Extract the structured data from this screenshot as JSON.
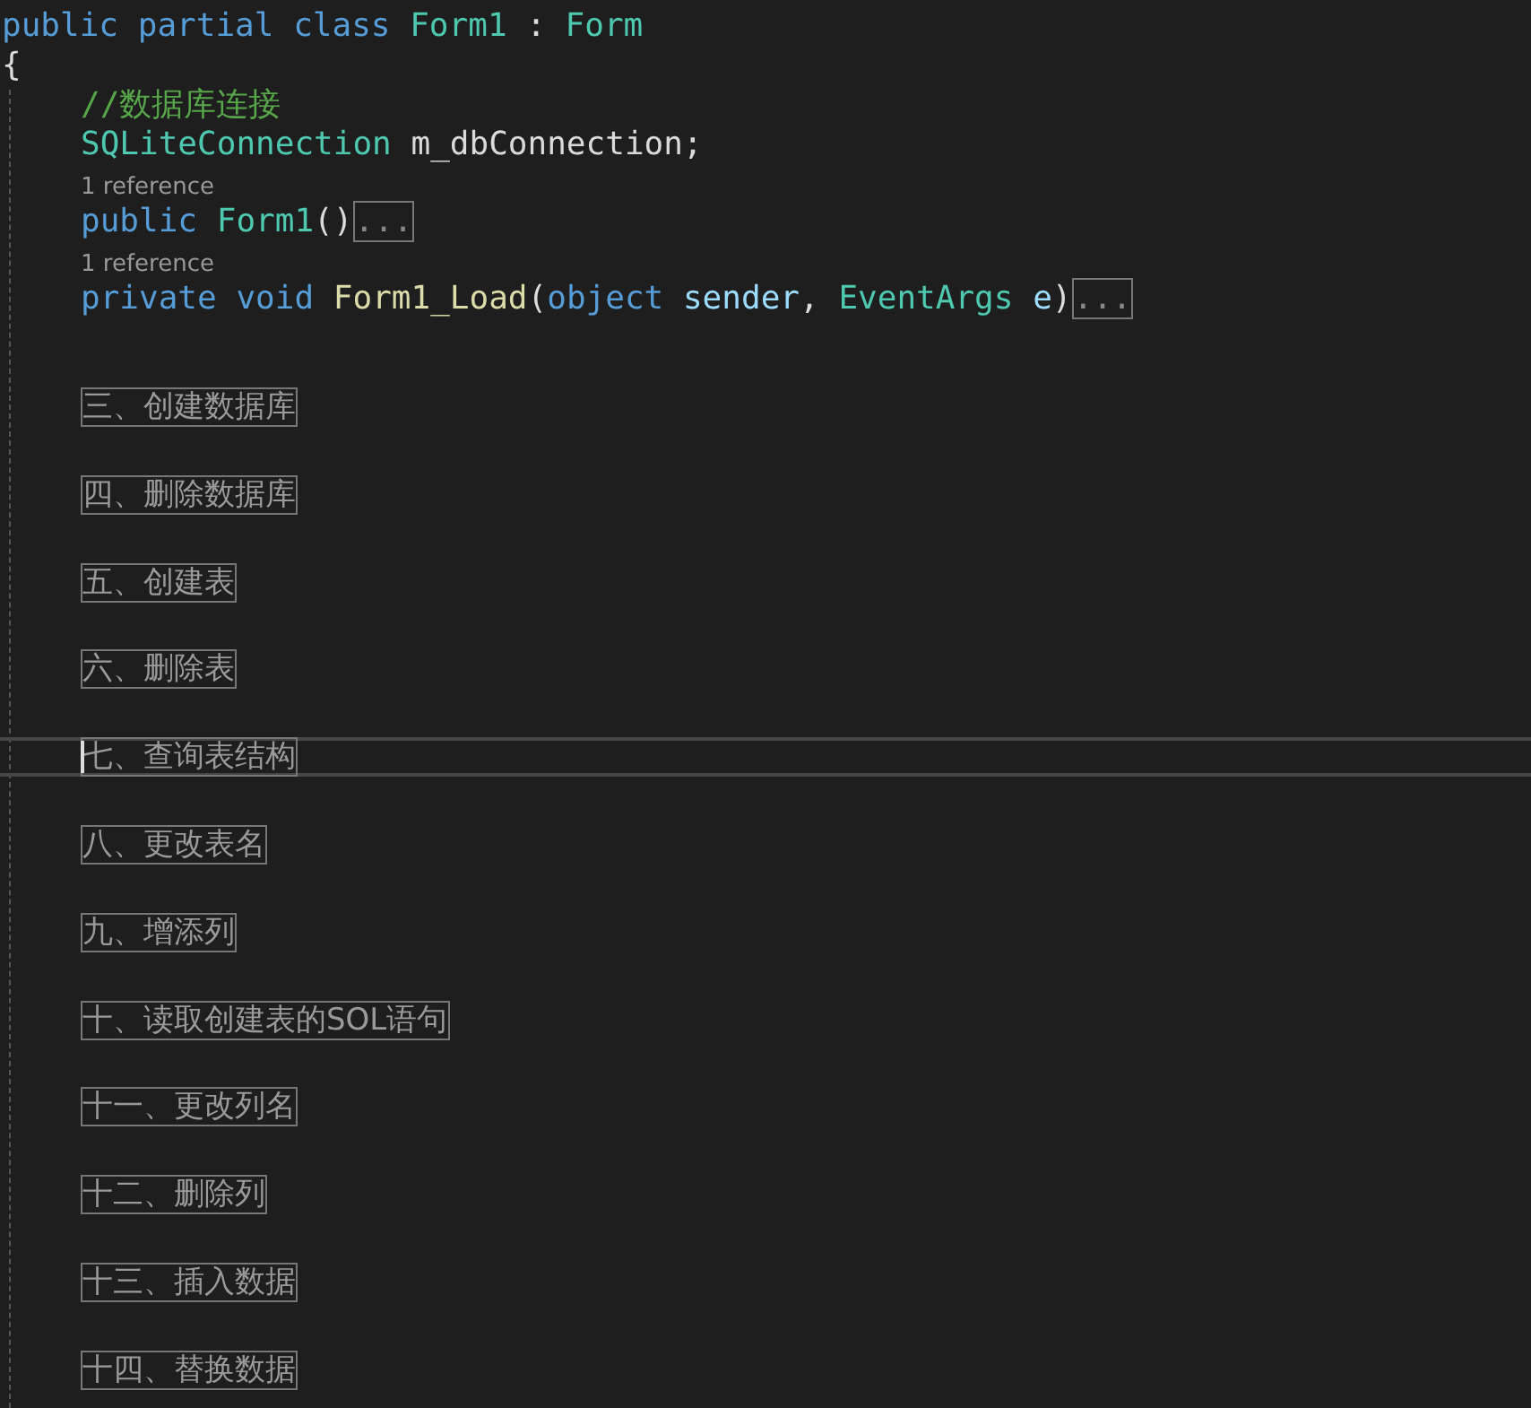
{
  "code_lines": [
    {
      "kind": "code",
      "tokens": [
        {
          "kind": "keyword",
          "text": "public "
        },
        {
          "kind": "keyword",
          "text": "partial "
        },
        {
          "kind": "keyword",
          "text": "class "
        },
        {
          "kind": "type",
          "text": "Form1"
        },
        {
          "kind": "plain",
          "text": " : "
        },
        {
          "kind": "type",
          "text": "Form"
        }
      ]
    },
    {
      "kind": "code",
      "tokens": [
        {
          "kind": "plain",
          "text": "{"
        }
      ]
    }
  ],
  "class_body": [
    {
      "kind": "code",
      "tokens": [
        {
          "kind": "comment",
          "text": "//数据库连接"
        }
      ]
    },
    {
      "kind": "code",
      "tokens": [
        {
          "kind": "type",
          "text": "SQLiteConnection "
        },
        {
          "kind": "field",
          "text": "m_dbConnection"
        },
        {
          "kind": "plain",
          "text": ";"
        }
      ]
    },
    {
      "kind": "codelens",
      "text": "1 reference"
    },
    {
      "kind": "code",
      "tokens": [
        {
          "kind": "keyword",
          "text": "public "
        },
        {
          "kind": "type",
          "text": "Form1"
        },
        {
          "kind": "plain",
          "text": "()"
        },
        {
          "kind": "ellipsis",
          "text": "..."
        }
      ]
    },
    {
      "kind": "codelens",
      "text": "1 reference"
    },
    {
      "kind": "code",
      "tokens": [
        {
          "kind": "keyword",
          "text": "private "
        },
        {
          "kind": "keyword",
          "text": "void "
        },
        {
          "kind": "method",
          "text": "Form1_Load"
        },
        {
          "kind": "plain",
          "text": "("
        },
        {
          "kind": "keyword",
          "text": "object "
        },
        {
          "kind": "param",
          "text": "sender"
        },
        {
          "kind": "plain",
          "text": ", "
        },
        {
          "kind": "type",
          "text": "EventArgs "
        },
        {
          "kind": "param",
          "text": "e"
        },
        {
          "kind": "plain",
          "text": ")"
        },
        {
          "kind": "ellipsis",
          "text": "..."
        }
      ]
    }
  ],
  "collapsed_regions": [
    {
      "text": "三、创建数据库",
      "current": false
    },
    {
      "text": "四、删除数据库",
      "current": false
    },
    {
      "text": "五、创建表",
      "current": false
    },
    {
      "text": "六、删除表",
      "current": false
    },
    {
      "text": "七、查询表结构",
      "current": true
    },
    {
      "text": "八、更改表名",
      "current": false
    },
    {
      "text": "九、增添列",
      "current": false
    },
    {
      "text": "十、读取创建表的SOL语句",
      "current": false
    },
    {
      "text": "十一、更改列名",
      "current": false
    },
    {
      "text": "十二、删除列",
      "current": false
    },
    {
      "text": "十三、插入数据",
      "current": false
    },
    {
      "text": "十四、替换数据",
      "current": false
    }
  ]
}
